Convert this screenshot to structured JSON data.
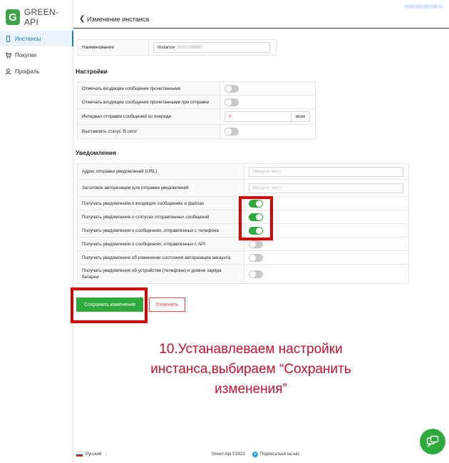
{
  "brand": {
    "logo_letter": "G",
    "name": "GREEN-API",
    "color": "#3fa14a"
  },
  "sidebar": {
    "items": [
      {
        "label": "Инстансы",
        "icon": "phone-icon",
        "active": true
      },
      {
        "label": "Покупки",
        "icon": "cart-icon",
        "active": false
      },
      {
        "label": "Профиль",
        "icon": "user-icon",
        "active": false
      }
    ]
  },
  "header": {
    "title": "Изменение инстанса",
    "user_email": "example@mail.ru"
  },
  "name_row": {
    "label": "Наименование",
    "value_prefix": "Instance",
    "value_id": "1101234567"
  },
  "settings": {
    "title": "Настройки",
    "rows": [
      {
        "label": "Отмечать входящие сообщения прочитанными",
        "type": "toggle",
        "on": false
      },
      {
        "label": "Отмечать входящие сообщения прочитанными при отправке",
        "type": "toggle",
        "on": false
      },
      {
        "label": "Интервал отправки сообщений из очереди",
        "type": "number",
        "value": "0",
        "unit": "мсек"
      },
      {
        "label": "Выставлять статус 'В сети'",
        "type": "toggle",
        "on": false
      }
    ]
  },
  "notifications": {
    "title": "Уведомления",
    "webhook_url_label": "Адрес отправки уведомлений (URL)",
    "webhook_url_placeholder": "Введите текст",
    "auth_header_label": "Заголовок авторизации для отправки уведомлений",
    "auth_header_placeholder": "Введите текст",
    "toggles": [
      {
        "label": "Получать уведомления о входящих сообщениях и файлах",
        "on": true
      },
      {
        "label": "Получать уведомления о статусах отправленных сообщений",
        "on": true
      },
      {
        "label": "Получать уведомления о сообщениях, отправленных с телефона",
        "on": true
      },
      {
        "label": "Получать уведомления о сообщениях, отправленных с API",
        "on": false
      },
      {
        "label": "Получать уведомления об изменении состояния авторизации аккаунта",
        "on": false
      },
      {
        "label": "Получать уведомления об устройстве (телефоне) и уровне заряда батареи",
        "on": false
      }
    ]
  },
  "actions": {
    "save_label": "Сохранить изменения",
    "cancel_label": "Отменить"
  },
  "caption": {
    "line1": "10.Устанавлеваем настройки",
    "line2": "инстанса,выбираем “Сохранить",
    "line3": "изменения”"
  },
  "footer": {
    "language": "Русский",
    "copyright": "Green-Api ©2023",
    "subscribe": "Подписаться на нас"
  },
  "colors": {
    "accent_green": "#2eaa3c",
    "highlight_red": "#e00000",
    "caption_red": "#c8102e",
    "link_blue": "#1976d2"
  }
}
